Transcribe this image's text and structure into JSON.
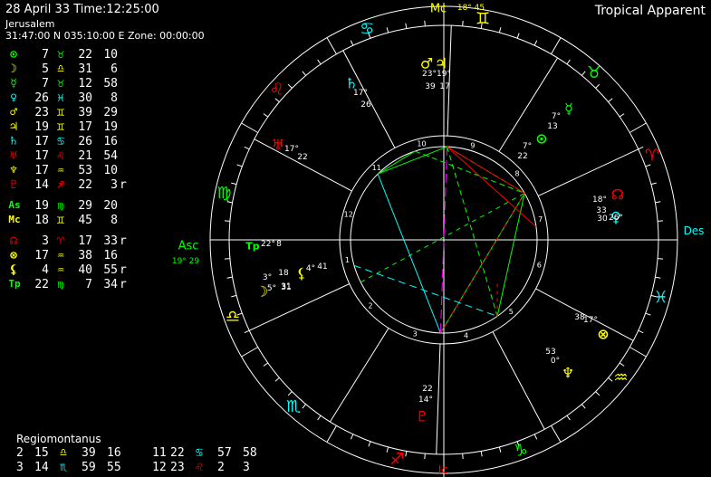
{
  "header": {
    "date_line": "28 April 33   Time:12:25:00",
    "place": "Jerusalem",
    "coords": "31:47:00 N 035:10:00 E  Zone: 00:00:00",
    "zodiac": "Tropical Apparent"
  },
  "colors": {
    "background": "#000000",
    "ring": "#ffffff",
    "yellow": "#ffff00",
    "green": "#00ff00",
    "red": "#ff0000",
    "cyan": "#00ffff",
    "magenta": "#ff00ff",
    "olive": "#808000",
    "white": "#ffffff"
  },
  "positions": [
    {
      "glyph": "⊙",
      "name": "sun-icon",
      "color": "#00ff00",
      "deg": "7",
      "sign": "♉",
      "sign_name": "taurus-icon",
      "sign_color": "#00ff00",
      "min": "22",
      "sec": "10",
      "retro": ""
    },
    {
      "glyph": "☽",
      "name": "moon-icon",
      "color": "#ffff00",
      "deg": "5",
      "sign": "♎",
      "sign_name": "libra-icon",
      "sign_color": "#ffff00",
      "min": "31",
      "sec": "6",
      "retro": ""
    },
    {
      "glyph": "☿",
      "name": "mercury-icon",
      "color": "#00ff00",
      "deg": "7",
      "sign": "♉",
      "sign_name": "taurus-icon",
      "sign_color": "#00ff00",
      "min": "12",
      "sec": "58",
      "retro": ""
    },
    {
      "glyph": "♀",
      "name": "venus-icon",
      "color": "#00ffff",
      "deg": "26",
      "sign": "♓",
      "sign_name": "pisces-icon",
      "sign_color": "#00ffff",
      "min": "30",
      "sec": "8",
      "retro": ""
    },
    {
      "glyph": "♂",
      "name": "mars-icon",
      "color": "#ffff00",
      "deg": "23",
      "sign": "♊",
      "sign_name": "gemini-icon",
      "sign_color": "#ffff00",
      "min": "39",
      "sec": "29",
      "retro": ""
    },
    {
      "glyph": "♃",
      "name": "jupiter-icon",
      "color": "#ffff00",
      "deg": "19",
      "sign": "♊",
      "sign_name": "gemini-icon",
      "sign_color": "#ffff00",
      "min": "17",
      "sec": "19",
      "retro": ""
    },
    {
      "glyph": "♄",
      "name": "saturn-icon",
      "color": "#00ffff",
      "deg": "17",
      "sign": "♋",
      "sign_name": "cancer-icon",
      "sign_color": "#00ffff",
      "min": "26",
      "sec": "16",
      "retro": ""
    },
    {
      "glyph": "♅",
      "name": "uranus-icon",
      "color": "#ff0000",
      "deg": "17",
      "sign": "♌",
      "sign_name": "leo-icon",
      "sign_color": "#ff0000",
      "min": "21",
      "sec": "54",
      "retro": ""
    },
    {
      "glyph": "♆",
      "name": "neptune-icon",
      "color": "#ffff00",
      "deg": "17",
      "sign": "♒",
      "sign_name": "aquarius-icon",
      "sign_color": "#ffff00",
      "min": "53",
      "sec": "10",
      "retro": ""
    },
    {
      "glyph": "♇",
      "name": "pluto-icon",
      "color": "#ff0000",
      "deg": "14",
      "sign": "♐",
      "sign_name": "sagittarius-icon",
      "sign_color": "#ff0000",
      "min": "22",
      "sec": "3",
      "retro": "r"
    },
    {
      "glyph": "As",
      "name": "ascendant-label",
      "color": "#00ff00",
      "deg": "19",
      "sign": "♍",
      "sign_name": "virgo-icon",
      "sign_color": "#00ff00",
      "min": "29",
      "sec": "20",
      "retro": ""
    },
    {
      "glyph": "Mc",
      "name": "midheaven-label",
      "color": "#ffff00",
      "deg": "18",
      "sign": "♊",
      "sign_name": "gemini-icon",
      "sign_color": "#ffff00",
      "min": "45",
      "sec": "8",
      "retro": ""
    },
    {
      "glyph": "☊",
      "name": "node-icon",
      "color": "#ff0000",
      "deg": "3",
      "sign": "♈",
      "sign_name": "aries-icon",
      "sign_color": "#ff0000",
      "min": "17",
      "sec": "33",
      "retro": "r"
    },
    {
      "glyph": "⊗",
      "name": "part-of-fortune-icon",
      "color": "#ffff00",
      "deg": "17",
      "sign": "♒",
      "sign_name": "aquarius-icon",
      "sign_color": "#ffff00",
      "min": "38",
      "sec": "16",
      "retro": ""
    },
    {
      "glyph": "⚸",
      "name": "lilith-icon",
      "color": "#ffff00",
      "deg": "4",
      "sign": "♒",
      "sign_name": "aquarius-icon",
      "sign_color": "#ffff00",
      "min": "40",
      "sec": "55",
      "retro": "r"
    },
    {
      "glyph": "Tp",
      "name": "transpluto-label",
      "color": "#00ff00",
      "deg": "22",
      "sign": "♍",
      "sign_name": "virgo-icon",
      "sign_color": "#00ff00",
      "min": "7",
      "sec": "34",
      "retro": "r"
    }
  ],
  "houses": {
    "title": "Regiomontanus",
    "rows": [
      [
        {
          "num": "2",
          "deg": "15",
          "sign": "♎",
          "sign_name": "libra-icon",
          "color": "#ffff00",
          "min": "39",
          "sec": "16"
        },
        {
          "num": "11",
          "deg": "22",
          "sign": "♋",
          "sign_name": "cancer-icon",
          "color": "#00ffff",
          "min": "57",
          "sec": "58"
        }
      ],
      [
        {
          "num": "3",
          "deg": "14",
          "sign": "♏",
          "sign_name": "scorpio-icon",
          "color": "#00ffff",
          "min": "59",
          "sec": "55"
        },
        {
          "num": "12",
          "deg": "23",
          "sign": "♌",
          "sign_name": "leo-icon",
          "color": "#ff0000",
          "min": "2",
          "sec": "3"
        }
      ]
    ]
  },
  "wheel": {
    "angles": {
      "asc": "Asc",
      "asc_pos": "19° 29",
      "mc": "Mc",
      "mc_pos": "18° 45",
      "des": "Des",
      "ic": "Ic"
    },
    "house_numbers": [
      "1",
      "2",
      "3",
      "4",
      "5",
      "6",
      "7",
      "8",
      "9",
      "10",
      "11",
      "12"
    ],
    "signs": [
      {
        "glyph": "♊",
        "name": "gemini-icon",
        "color": "#ffff00"
      },
      {
        "glyph": "♉",
        "name": "taurus-icon",
        "color": "#00ff00"
      },
      {
        "glyph": "♈",
        "name": "aries-icon",
        "color": "#ff0000"
      },
      {
        "glyph": "♓",
        "name": "pisces-icon",
        "color": "#00ffff"
      },
      {
        "glyph": "♒",
        "name": "aquarius-icon",
        "color": "#ffff00"
      },
      {
        "glyph": "♑",
        "name": "capricorn-icon",
        "color": "#00ff00"
      },
      {
        "glyph": "♐",
        "name": "sagittarius-icon",
        "color": "#ff0000"
      },
      {
        "glyph": "♏",
        "name": "scorpio-icon",
        "color": "#00ffff"
      },
      {
        "glyph": "♎",
        "name": "libra-icon",
        "color": "#ffff00"
      },
      {
        "glyph": "♍",
        "name": "virgo-icon",
        "color": "#00ff00"
      },
      {
        "glyph": "♌",
        "name": "leo-icon",
        "color": "#ff0000"
      },
      {
        "glyph": "♋",
        "name": "cancer-icon",
        "color": "#00ffff"
      }
    ],
    "planets": [
      {
        "glyph": "♂",
        "name": "wheel-mars",
        "color": "#ffff00",
        "deg": "23°",
        "min": "39"
      },
      {
        "glyph": "♃",
        "name": "wheel-jupiter",
        "color": "#ffff00",
        "deg": "19°",
        "min": "17"
      },
      {
        "glyph": "♄",
        "name": "wheel-saturn",
        "color": "#00ffff",
        "deg": "17°",
        "min": "26"
      },
      {
        "glyph": "♅",
        "name": "wheel-uranus",
        "color": "#ff0000",
        "deg": "17°",
        "min": "22"
      },
      {
        "glyph": "⊙",
        "name": "wheel-sun",
        "color": "#00ff00",
        "deg": "7°",
        "min": "22"
      },
      {
        "glyph": "☿",
        "name": "wheel-mercury",
        "color": "#00ff00",
        "deg": "7°",
        "min": "13"
      },
      {
        "glyph": "☊",
        "name": "wheel-node",
        "color": "#ff0000",
        "deg": "18°",
        "min": "33"
      },
      {
        "glyph": "♀",
        "name": "wheel-venus",
        "color": "#00ffff",
        "deg": "26°",
        "min": "30"
      },
      {
        "glyph": "Tp",
        "name": "wheel-transpluto",
        "color": "#00ff00",
        "deg": "22°",
        "min": "8"
      },
      {
        "glyph": "☽",
        "name": "wheel-moon",
        "color": "#ffff00",
        "deg": "5°",
        "min": "31"
      },
      {
        "glyph": "⚸",
        "name": "wheel-lilith",
        "color": "#ffff00",
        "deg": "4°",
        "min": "41"
      },
      {
        "glyph": "⊗",
        "name": "wheel-fortune",
        "color": "#ffff00",
        "deg": "17°",
        "min": "38"
      },
      {
        "glyph": "♆",
        "name": "wheel-neptune",
        "color": "#ffff00",
        "deg": "0°",
        "min": "53"
      },
      {
        "glyph": "♇",
        "name": "wheel-pluto",
        "color": "#ff0000",
        "deg": "14°",
        "min": "22"
      }
    ],
    "extra_labels": [
      "3°",
      "18",
      "31"
    ]
  }
}
